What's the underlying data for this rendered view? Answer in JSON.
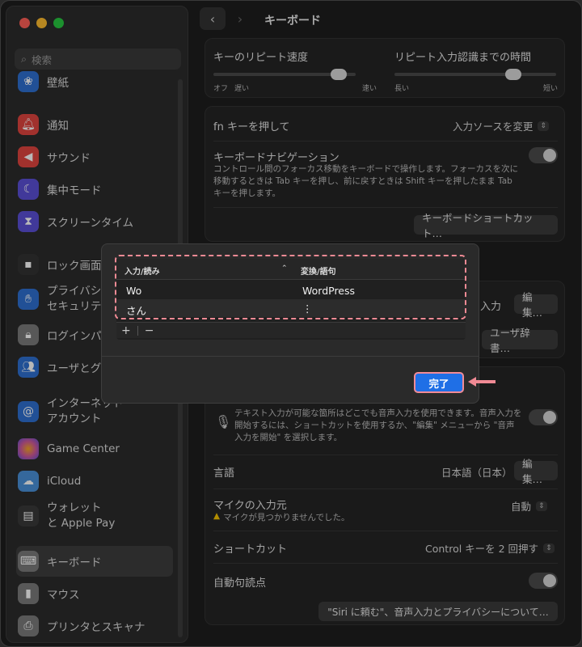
{
  "sidebar": {
    "search_placeholder": "検索",
    "items": [
      {
        "label": "壁紙",
        "icon": "wallpaper-icon",
        "color": "#2f6fd0"
      },
      {
        "label": "通知",
        "icon": "bell-icon",
        "color": "#e0453f"
      },
      {
        "label": "サウンド",
        "icon": "speaker-icon",
        "color": "#e0453f"
      },
      {
        "label": "集中モード",
        "icon": "moon-icon",
        "color": "#5b4fd6"
      },
      {
        "label": "スクリーンタイム",
        "icon": "hourglass-icon",
        "color": "#5b4fd6"
      },
      {
        "label": "ロック画面",
        "icon": "lock-screen-icon",
        "color": "#333333"
      },
      {
        "label": "プライバシーと\nセキュリティ",
        "icon": "hand-icon",
        "color": "#2f6fd0"
      },
      {
        "label": "ログインパスワード",
        "icon": "lock-icon",
        "color": "#7a7a7a"
      },
      {
        "label": "ユーザとグループ",
        "icon": "users-icon",
        "color": "#2f6fd0"
      },
      {
        "label": "インターネット\nアカウント",
        "icon": "at-icon",
        "color": "#2f6fd0"
      },
      {
        "label": "Game Center",
        "icon": "game-center-icon",
        "color": "#d05a9a"
      },
      {
        "label": "iCloud",
        "icon": "cloud-icon",
        "color": "#4a90d9"
      },
      {
        "label": "ウォレット\nと Apple Pay",
        "icon": "wallet-icon",
        "color": "#3a3a3a"
      },
      {
        "label": "キーボード",
        "icon": "keyboard-icon",
        "color": "#7a7a7a"
      },
      {
        "label": "マウス",
        "icon": "mouse-icon",
        "color": "#7a7a7a"
      },
      {
        "label": "プリンタとスキャナ",
        "icon": "printer-icon",
        "color": "#7a7a7a"
      }
    ]
  },
  "toolbar": {
    "back": "‹",
    "forward": "›",
    "title": "キーボード"
  },
  "keyboard": {
    "repeat_rate_label": "キーのリピート速度",
    "repeat_rate_min": "オフ",
    "repeat_rate_slow": "遅い",
    "repeat_rate_fast": "速い",
    "repeat_rate_value": 0.93,
    "delay_label": "リピート入力認識までの時間",
    "delay_long": "長い",
    "delay_short": "短い",
    "delay_value": 0.76,
    "fn_label": "fn キーを押して",
    "fn_value": "入力ソースを変更",
    "nav_label": "キーボードナビゲーション",
    "nav_desc": "コントロール間のフォーカス移動をキーボードで操作します。フォーカスを次に移動するときは Tab キーを押し、前に戻すときは Shift キーを押したまま Tab キーを押します。",
    "shortcut_button": "キーボードショートカット…",
    "input_partial": "入力",
    "edit_button": "編集…",
    "user_dict_button": "ユーザ辞書…"
  },
  "dictation": {
    "desc": "テキスト入力が可能な箇所はどこでも音声入力を使用できます。音声入力を開始するには、ショートカットを使用するか、\"編集\" メニューから \"音声入力を開始\" を選択します。",
    "language_label": "言語",
    "language_value": "日本語（日本）",
    "language_edit": "編集…",
    "mic_label": "マイクの入力元",
    "mic_warning": "マイクが見つかりませんでした。",
    "mic_value": "自動",
    "shortcut_label": "ショートカット",
    "shortcut_value": "Control キーを 2 回押す",
    "punct_label": "自動句読点",
    "siri_button": "\"Siri に頼む\"、音声入力とプライバシーについて…"
  },
  "sheet": {
    "col_input": "入力/読み",
    "col_output": "変換/語句",
    "sort_icon": "chevron-up-icon",
    "rows": [
      {
        "input": "Wo",
        "output": "WordPress"
      },
      {
        "input": "さん",
        "output": "⋮"
      }
    ],
    "add": "+",
    "remove": "−",
    "done": "完了"
  },
  "colors": {
    "accent": "#1f6fe6",
    "highlight": "#f08a94"
  }
}
